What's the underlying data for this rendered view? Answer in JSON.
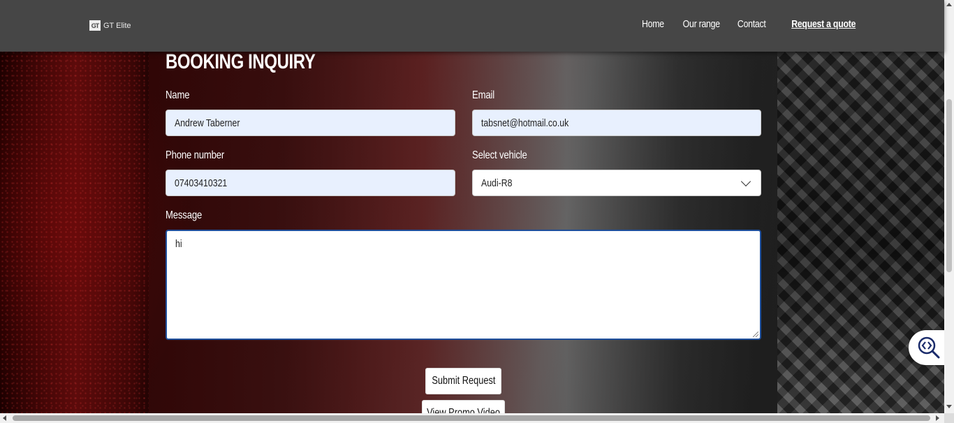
{
  "navbar": {
    "logo_mark": "GT",
    "logo_text": "GT Elite",
    "links": [
      {
        "label": "Home"
      },
      {
        "label": "Our range"
      },
      {
        "label": "Contact"
      },
      {
        "label": "Request a quote",
        "active": true
      }
    ]
  },
  "form": {
    "heading": "BOOKING INQUIRY",
    "name": {
      "label": "Name",
      "value": "Andrew Taberner"
    },
    "email": {
      "label": "Email",
      "value": "tabsnet@hotmail.co.uk"
    },
    "phone": {
      "label": "Phone number",
      "value": "07403410321"
    },
    "vehicle": {
      "label": "Select vehicle",
      "value": "Audi-R8"
    },
    "message": {
      "label": "Message",
      "value": "hi"
    },
    "submit_label": "Submit Request",
    "promo_label": "View Promo Video"
  },
  "colors": {
    "navbar": "#464646",
    "focus_border": "#1e4f9c",
    "autofill_bg": "#e8f0fe"
  },
  "icons": {
    "widget": "zoom-code-icon",
    "vehicle_select": "chevron-down-icon"
  }
}
